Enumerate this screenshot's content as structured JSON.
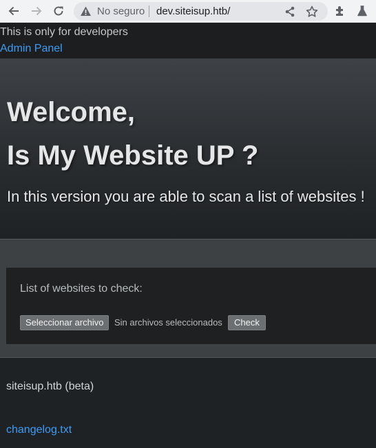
{
  "browser": {
    "security_label": "No seguro",
    "url": "dev.siteisup.htb/"
  },
  "dev_bar": {
    "note": "This is only for developers",
    "admin_link": "Admin Panel"
  },
  "hero": {
    "welcome": "Welcome,",
    "title": "Is My Website UP ?",
    "lead": "In this version you are able to scan a list of websites !"
  },
  "form": {
    "label": "List of websites to check:",
    "file_button": "Seleccionar archivo",
    "file_status": "Sin archivos seleccionados",
    "check_button": "Check"
  },
  "footer": {
    "brand": "siteisup.htb (beta)",
    "changelog_link": "changelog.txt"
  },
  "colors": {
    "link": "#3d9cf5",
    "page_bg": "#1f2224",
    "card_bg": "#1e2022"
  },
  "icons": [
    "back-icon",
    "forward-icon",
    "reload-icon",
    "warning-icon",
    "share-icon",
    "star-icon",
    "extensions-icon",
    "labs-icon"
  ]
}
